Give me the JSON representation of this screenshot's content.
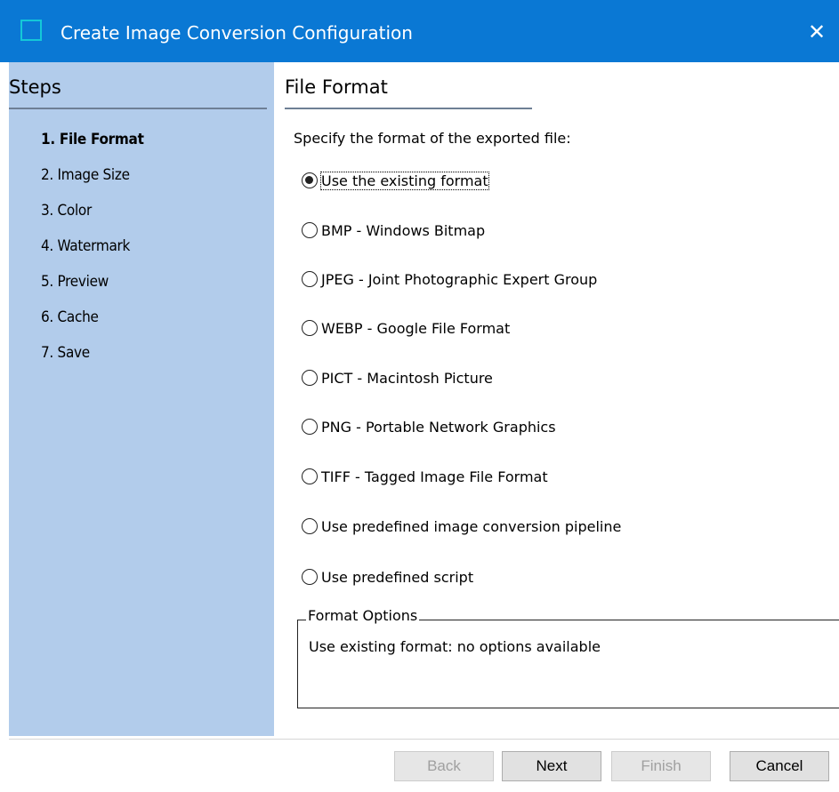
{
  "window": {
    "title": "Create Image Conversion Configuration",
    "close_glyph": "✕",
    "titlebar_color": "#0a78d4"
  },
  "steps": {
    "title": "Steps",
    "items": [
      {
        "label": "1. File Format",
        "active": true
      },
      {
        "label": "2. Image Size",
        "active": false
      },
      {
        "label": "3. Color",
        "active": false
      },
      {
        "label": "4. Watermark",
        "active": false
      },
      {
        "label": "5. Preview",
        "active": false
      },
      {
        "label": "6. Cache",
        "active": false
      },
      {
        "label": "7. Save",
        "active": false
      }
    ],
    "pane_color": "#b2cceb"
  },
  "main": {
    "section_title": "File Format",
    "prompt": "Specify the format of the exported file:",
    "options": [
      {
        "label": "Use the existing format",
        "selected": true
      },
      {
        "label": "BMP - Windows Bitmap",
        "selected": false
      },
      {
        "label": "JPEG - Joint Photographic Expert Group",
        "selected": false
      },
      {
        "label": "WEBP - Google File Format",
        "selected": false
      },
      {
        "label": "PICT - Macintosh Picture",
        "selected": false
      },
      {
        "label": "PNG - Portable Network Graphics",
        "selected": false
      },
      {
        "label": "TIFF - Tagged Image File Format",
        "selected": false
      },
      {
        "label": "Use predefined image conversion pipeline",
        "selected": false
      },
      {
        "label": "Use predefined script",
        "selected": false
      }
    ],
    "format_options": {
      "legend": "Format Options",
      "text": "Use existing format: no options available"
    }
  },
  "footer": {
    "back_label": "Back",
    "next_label": "Next",
    "finish_label": "Finish",
    "cancel_label": "Cancel"
  }
}
